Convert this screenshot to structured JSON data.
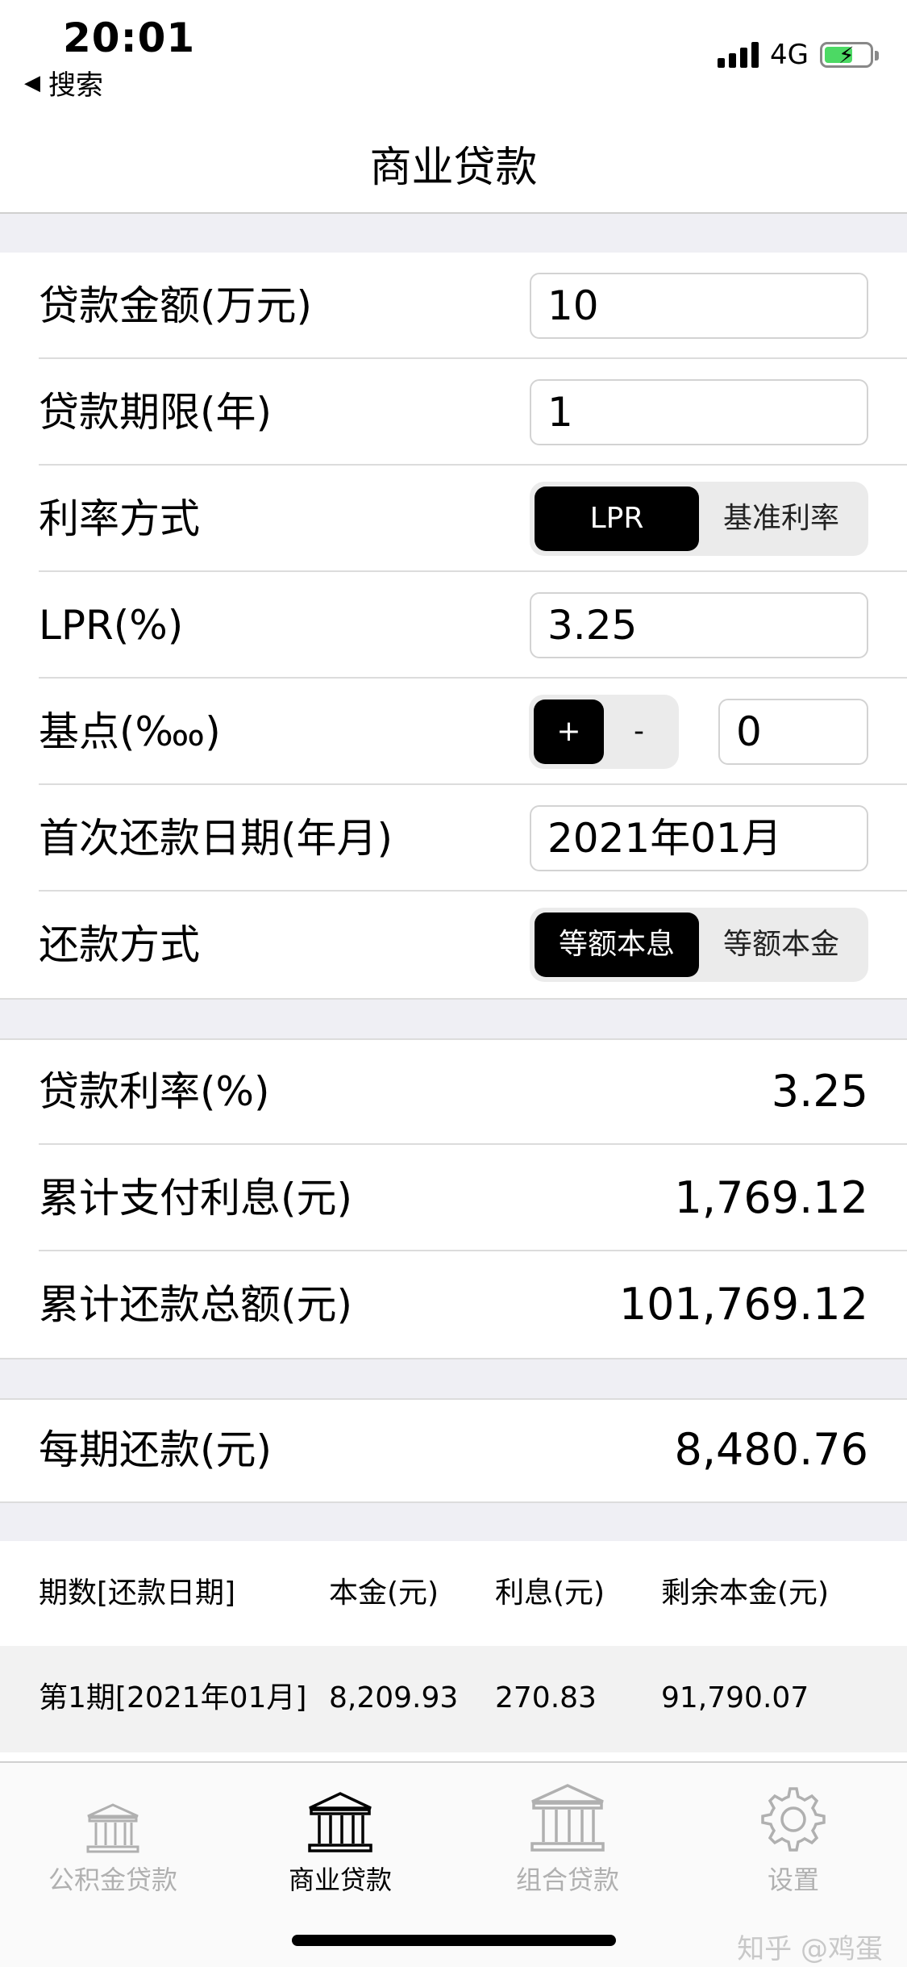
{
  "status_bar": {
    "time": "20:01",
    "back_label": "搜索",
    "network": "4G"
  },
  "nav": {
    "title": "商业贷款"
  },
  "form": {
    "loan_amount": {
      "label": "贷款金额(万元)",
      "value": "10"
    },
    "loan_term": {
      "label": "贷款期限(年)",
      "value": "1"
    },
    "rate_mode": {
      "label": "利率方式",
      "options": [
        "LPR",
        "基准利率"
      ],
      "selected": "LPR"
    },
    "lpr": {
      "label": "LPR(%)",
      "value": "3.25"
    },
    "basis_point": {
      "label": "基点(‱)",
      "plus": "+",
      "minus": "-",
      "value": "0"
    },
    "first_payment_date": {
      "label": "首次还款日期(年月)",
      "value": "2021年01月"
    },
    "repayment_mode": {
      "label": "还款方式",
      "options": [
        "等额本息",
        "等额本金"
      ],
      "selected": "等额本息"
    }
  },
  "results": {
    "loan_rate": {
      "label": "贷款利率(%)",
      "value": "3.25"
    },
    "total_interest": {
      "label": "累计支付利息(元)",
      "value": "1,769.12"
    },
    "total_repayment": {
      "label": "累计还款总额(元)",
      "value": "101,769.12"
    },
    "monthly_payment": {
      "label": "每期还款(元)",
      "value": "8,480.76"
    }
  },
  "schedule": {
    "headers": [
      "期数[还款日期]",
      "本金(元)",
      "利息(元)",
      "剩余本金(元)"
    ],
    "rows": [
      [
        "第1期[2021年01月]",
        "8,209.93",
        "270.83",
        "91,790.07"
      ]
    ]
  },
  "tabs": [
    {
      "label": "公积金贷款",
      "icon": "bank-icon",
      "active": false
    },
    {
      "label": "商业贷款",
      "icon": "bank-icon",
      "active": true
    },
    {
      "label": "组合贷款",
      "icon": "bank-icon",
      "active": false
    },
    {
      "label": "设置",
      "icon": "gear-icon",
      "active": false
    }
  ],
  "watermark": "知乎 @鸡蛋",
  "colors": {
    "accent": "#000000",
    "battery": "#4cd964",
    "inactive_tab": "#b0b0b0",
    "section_bg": "#efeff4"
  }
}
